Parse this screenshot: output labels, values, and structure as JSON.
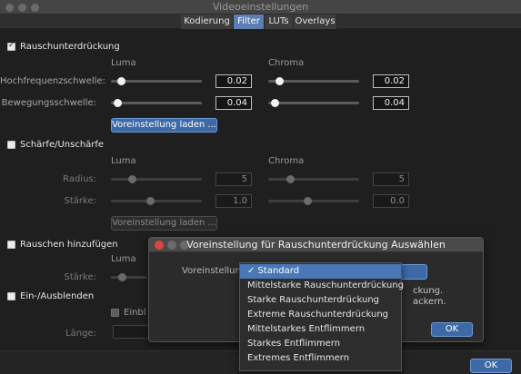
{
  "window": {
    "title": "Videoeinstellungen"
  },
  "tabs": [
    {
      "label": "Kodierung",
      "active": false
    },
    {
      "label": "Filter",
      "active": true
    },
    {
      "label": "LUTs",
      "active": false
    },
    {
      "label": "Overlays",
      "active": false
    }
  ],
  "denoise": {
    "title": "Rauschunterdrückung",
    "checked": true,
    "luma_label": "Luma",
    "chroma_label": "Chroma",
    "rows": [
      {
        "label": "Hochfrequenzschwelle:",
        "luma_value": "0.02",
        "chroma_value": "0.02"
      },
      {
        "label": "Bewegungsschwelle:",
        "luma_value": "0.04",
        "chroma_value": "0.04"
      }
    ],
    "preset_button": "Voreinstellung laden ..."
  },
  "sharpen": {
    "title": "Schärfe/Unschärfe",
    "checked": false,
    "luma_label": "Luma",
    "chroma_label": "Chroma",
    "rows": [
      {
        "label": "Radius:",
        "luma_value": "5",
        "chroma_value": "5"
      },
      {
        "label": "Stärke:",
        "luma_value": "1.0",
        "chroma_value": "0.0"
      }
    ],
    "preset_button": "Voreinstellung laden ..."
  },
  "noise": {
    "title": "Rauschen hinzufügen",
    "checked": false,
    "luma_label": "Luma",
    "strength_label": "Stärke:"
  },
  "fade": {
    "title": "Ein-/Ausblenden",
    "checked": false,
    "fade_in_label": "Einbl",
    "length_label": "Länge:"
  },
  "dialog": {
    "title": "Voreinstellung für Rauschunterdrückung Auswählen",
    "field_label": "Voreinstellung:",
    "hint_line1": "ckung.",
    "hint_line2": "ackern.",
    "ok_label": "OK"
  },
  "dropdown": {
    "options": [
      {
        "label": "✓ Standard",
        "selected": true
      },
      {
        "label": "Mittelstarke Rauschunterdrückung",
        "selected": false
      },
      {
        "label": "Starke Rauschunterdrückung",
        "selected": false
      },
      {
        "label": "Extreme Rauschunterdrückung",
        "selected": false
      },
      {
        "label": "Mittelstarkes Entflimmern",
        "selected": false
      },
      {
        "label": "Starkes Entflimmern",
        "selected": false
      },
      {
        "label": "Extremes Entflimmern",
        "selected": false
      }
    ]
  },
  "footer": {
    "ok_label": "OK"
  },
  "colors": {
    "accent": "#3d6aa6",
    "selection": "#4a77b6",
    "background": "#1f1f1f"
  }
}
